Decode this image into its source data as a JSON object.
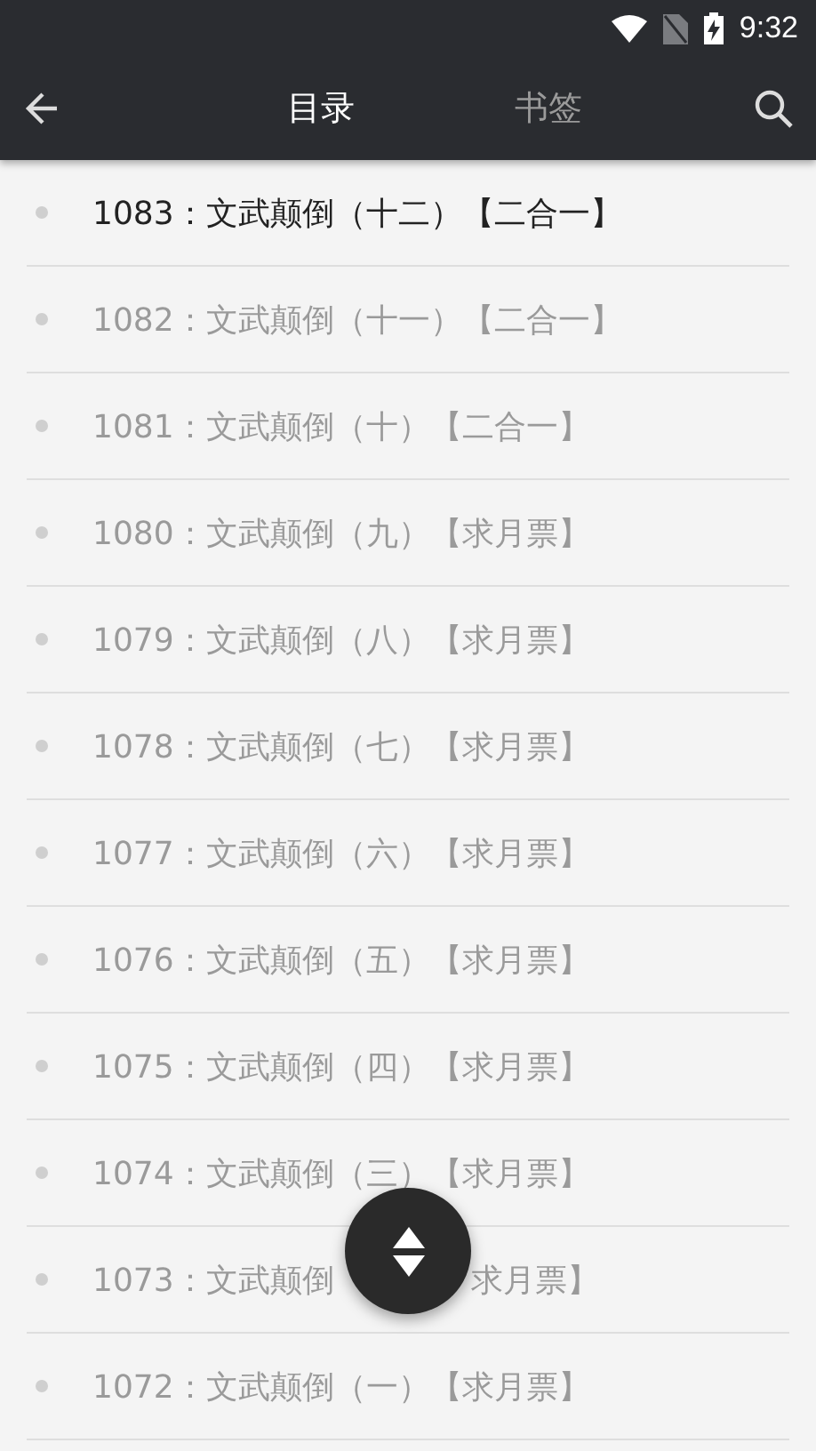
{
  "status_bar": {
    "time": "9:32"
  },
  "app_bar": {
    "tabs": [
      {
        "label": "目录",
        "selected": true
      },
      {
        "label": "书签",
        "selected": false
      }
    ]
  },
  "chapters": [
    {
      "title": "1083：文武颠倒（十二）【二合一】",
      "current": true
    },
    {
      "title": "1082：文武颠倒（十一）【二合一】",
      "current": false
    },
    {
      "title": "1081：文武颠倒（十）【二合一】",
      "current": false
    },
    {
      "title": "1080：文武颠倒（九）【求月票】",
      "current": false
    },
    {
      "title": "1079：文武颠倒（八）【求月票】",
      "current": false
    },
    {
      "title": "1078：文武颠倒（七）【求月票】",
      "current": false
    },
    {
      "title": "1077：文武颠倒（六）【求月票】",
      "current": false
    },
    {
      "title": "1076：文武颠倒（五）【求月票】",
      "current": false
    },
    {
      "title": "1075：文武颠倒（四）【求月票】",
      "current": false
    },
    {
      "title": "1074：文武颠倒（三）【求月票】",
      "current": false
    },
    {
      "title": "1073：文武颠倒",
      "title_tail": "求月票】",
      "current": false
    },
    {
      "title": "1072：文武颠倒（一）【求月票】",
      "current": false
    }
  ]
}
